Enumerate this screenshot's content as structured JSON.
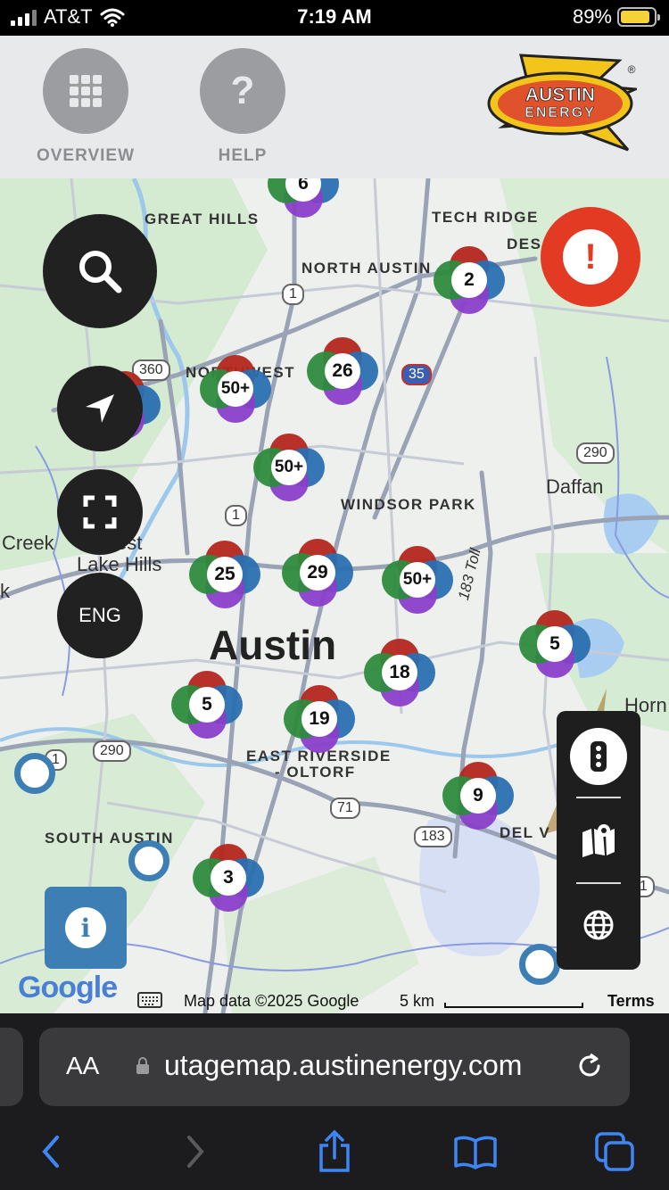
{
  "status_bar": {
    "carrier": "AT&T",
    "time": "7:19 AM",
    "battery": "89%",
    "battery_level": 0.89
  },
  "header": {
    "overview_label": "OVERVIEW",
    "help_label": "HELP",
    "help_glyph": "?",
    "logo_line1": "AUSTIN",
    "logo_line2": "ENERGY",
    "logo_mark": "®"
  },
  "map": {
    "places": {
      "great_hills": "GREAT HILLS",
      "tech_ridge": "TECH RIDGE",
      "des": "DES",
      "north_austin": "NORTH AUSTIN",
      "northwest": "NORTHWEST",
      "windsor_park": "WINDSOR PARK",
      "daffan": "Daffan",
      "creek": "Creek",
      "west_lake_hills_1": "est",
      "west_lake_hills_2": "Lake Hills",
      "k": "k",
      "austin": "Austin",
      "east_riverside_1": "EAST RIVERSIDE",
      "east_riverside_2": "- OLTORF",
      "south_austin": "SOUTH AUSTIN",
      "del_valle": "DEL V",
      "horn": "Horn",
      "toll_183": "183 Toll"
    },
    "shields": {
      "s1a": "1",
      "s1b": "1",
      "s1c": "1",
      "s360": "360",
      "s35": "35",
      "s290a": "290",
      "s290b": "290",
      "s71a": "71",
      "s71b": "71",
      "s183": "183"
    },
    "clusters": {
      "c1": "6",
      "c2": "2",
      "c3": "50+",
      "c4": "26",
      "c5": "50+",
      "c6": "25",
      "c7": "29",
      "c8": "50+",
      "c9": "5",
      "c10": "18",
      "c11": "5",
      "c12": "19",
      "c13": "9",
      "c14": "3"
    },
    "alert_glyph": "!",
    "locale_button": "ENG",
    "info_glyph": "i",
    "google": "Google",
    "map_data": "Map data ©2025 Google",
    "scale": "5 km",
    "terms": "Terms"
  },
  "browser": {
    "text_size": "AA",
    "url": "utagemap.austinenergy.com"
  },
  "colors": {
    "alert": "#e23a23",
    "accent_blue": "#3d7fb4",
    "panel": "#212121"
  }
}
